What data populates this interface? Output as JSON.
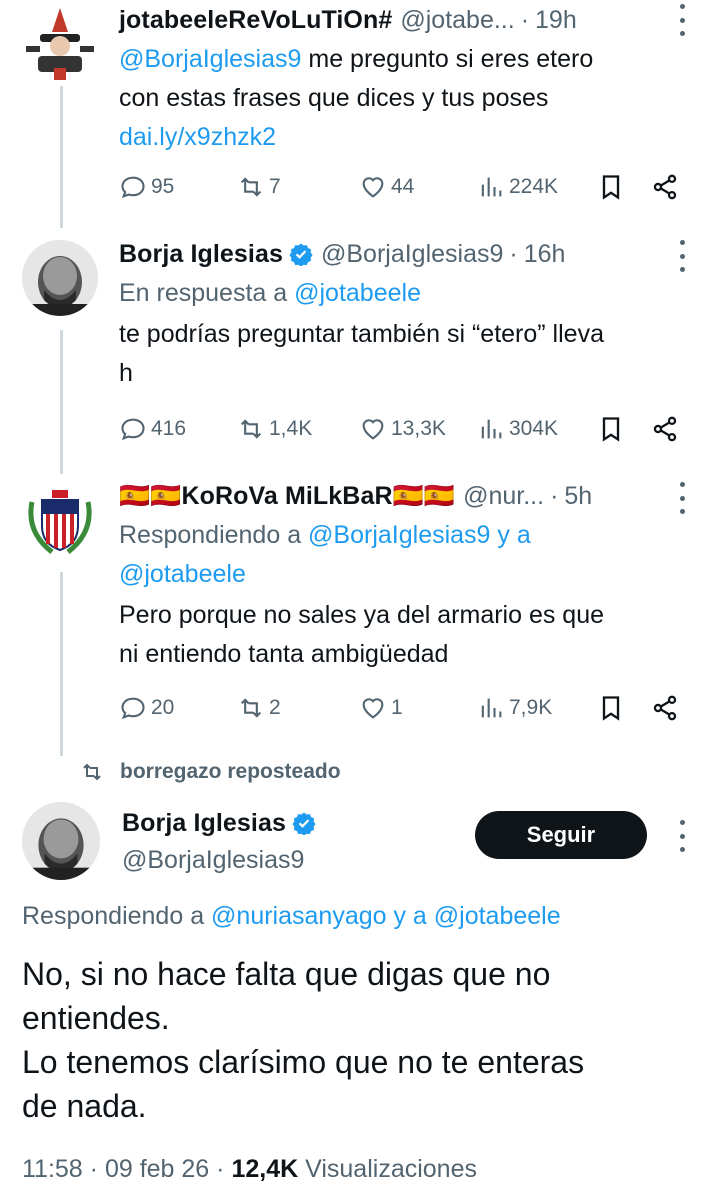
{
  "tweets": [
    {
      "name": "jotabeeleReVoLuTiOn#",
      "handle": "@jotabe...",
      "time": "19h",
      "text_mention": "@BorjaIglesias9",
      "text_line1_rest": " me pregunto si eres etero",
      "text_line2": "con estas frases que dices y tus poses",
      "text_link": "dai.ly/x9zhzk2",
      "replies": "95",
      "reposts": "7",
      "likes": "44",
      "views": "224K"
    },
    {
      "name": "Borja Iglesias",
      "handle": "@BorjaIglesias9",
      "time": "16h",
      "reply_prefix": "En respuesta a ",
      "reply_to": "@jotabeele",
      "text_line1": "te podrías preguntar también si “etero” lleva",
      "text_line2": "h",
      "replies": "416",
      "reposts": "1,4K",
      "likes": "13,3K",
      "views": "304K"
    },
    {
      "name": "🇪🇸🇪🇸KoRoVa MiLkBaR🇪🇸🇪🇸",
      "handle": "@nur...",
      "time": "5h",
      "reply_prefix": "Respondiendo a ",
      "reply_to_1": "@BorjaIglesias9 y a",
      "reply_to_2": "@jotabeele",
      "text_line1": "Pero porque no sales ya del armario es que",
      "text_line2": "ni entiendo tanta ambigüedad",
      "replies": "20",
      "reposts": "2",
      "likes": "1",
      "views": "7,9K"
    }
  ],
  "repost_banner": "borregazo reposteado",
  "main": {
    "name": "Borja Iglesias",
    "handle": "@BorjaIglesias9",
    "follow_label": "Seguir",
    "reply_prefix": "Respondiendo a ",
    "reply_to": "@nuriasanyago y a @jotabeele",
    "text_line1": "No, si no hace falta que digas que no",
    "text_line2": "entiendes.",
    "text_line3": "Lo tenemos clarísimo que no te enteras",
    "text_line4": "de nada.",
    "time": "11:58",
    "date": "09 feb 26",
    "views": "12,4K",
    "views_label": "Visualizaciones"
  },
  "colors": {
    "link": "#1d9bf0",
    "secondary": "#536471",
    "line": "#cfd9de",
    "verified": "#1d9bf0"
  }
}
